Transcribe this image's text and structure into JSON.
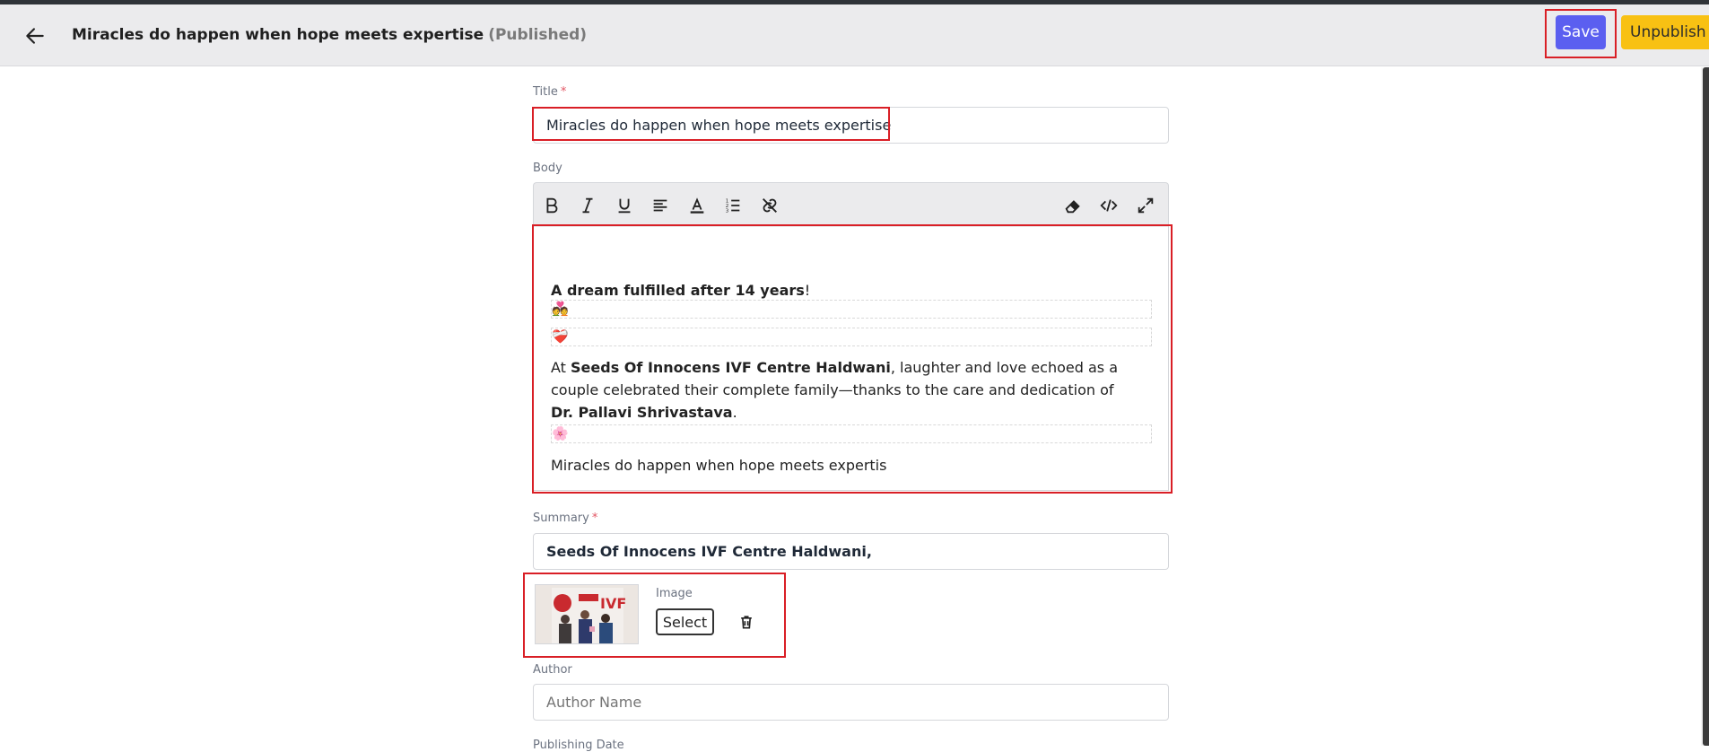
{
  "header": {
    "title": "Miracles do happen when hope meets expertise",
    "status": "(Published)",
    "save_label": "Save",
    "unpublish_label": "Unpublish"
  },
  "form": {
    "title_label": "Title",
    "title_required": "*",
    "title_value": "Miracles do happen when hope meets expertise",
    "body_label": "Body",
    "summary_label": "Summary",
    "summary_required": "*",
    "summary_value": "Seeds Of Innocens IVF Centre Haldwani,",
    "image_label": "Image",
    "select_label": "Select",
    "author_label": "Author",
    "author_placeholder": "Author Name",
    "publishing_date_label": "Publishing Date"
  },
  "body": {
    "line1_bold": "A dream fulfilled after 14 years",
    "line1_rest": "!",
    "emoji1": "💑",
    "emoji2": "❤️‍🩹",
    "para_intro": "At ",
    "para_clinic": "Seeds Of Innocens IVF Centre Haldwani",
    "para_mid": ", laughter and love echoed as a couple celebrated their complete family—thanks to the care and dedication of ",
    "para_doctor": "Dr. Pallavi Shrivastava",
    "para_end": ".",
    "emoji3": "🌸",
    "last_line": "Miracles do happen when hope meets expertis"
  },
  "toolbar": {
    "icons": [
      "bold-icon",
      "italic-icon",
      "underline-icon",
      "align-icon",
      "font-color-icon",
      "ordered-list-icon",
      "link-icon",
      "eraser-icon",
      "code-view-icon",
      "fullscreen-icon"
    ]
  },
  "colors": {
    "save": "#5b5ff0",
    "unpublish": "#f8c113",
    "highlight": "#d91f26",
    "header_bg": "#ebebed"
  }
}
